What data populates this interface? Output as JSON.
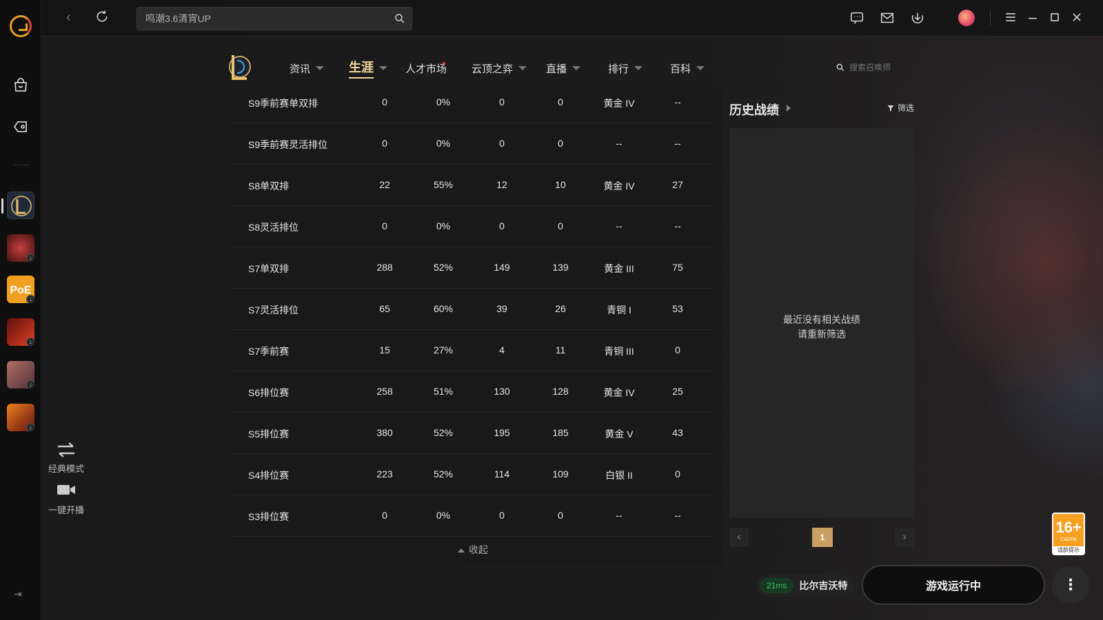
{
  "search": {
    "value": "鸣潮3.6清宵UP"
  },
  "nav": {
    "items": [
      {
        "label": "资讯"
      },
      {
        "label": "生涯"
      },
      {
        "label": "人才市场"
      },
      {
        "label": "云顶之弈"
      },
      {
        "label": "直播"
      },
      {
        "label": "排行"
      },
      {
        "label": "百科"
      }
    ],
    "summoner_search_placeholder": "搜索召唤师"
  },
  "stats_rows": [
    [
      "S9季前赛单双排",
      "0",
      "0%",
      "0",
      "0",
      "黄金 IV",
      "--"
    ],
    [
      "S9季前赛灵活排位",
      "0",
      "0%",
      "0",
      "0",
      "--",
      "--"
    ],
    [
      "S8单双排",
      "22",
      "55%",
      "12",
      "10",
      "黄金 IV",
      "27"
    ],
    [
      "S8灵活排位",
      "0",
      "0%",
      "0",
      "0",
      "--",
      "--"
    ],
    [
      "S7单双排",
      "288",
      "52%",
      "149",
      "139",
      "黄金 III",
      "75"
    ],
    [
      "S7灵活排位",
      "65",
      "60%",
      "39",
      "26",
      "青铜 I",
      "53"
    ],
    [
      "S7季前赛",
      "15",
      "27%",
      "4",
      "11",
      "青铜 III",
      "0"
    ],
    [
      "S6排位赛",
      "258",
      "51%",
      "130",
      "128",
      "黄金 IV",
      "25"
    ],
    [
      "S5排位赛",
      "380",
      "52%",
      "195",
      "185",
      "黄金 V",
      "43"
    ],
    [
      "S4排位赛",
      "223",
      "52%",
      "114",
      "109",
      "白银 II",
      "0"
    ],
    [
      "S3排位赛",
      "0",
      "0%",
      "0",
      "0",
      "--",
      "--"
    ]
  ],
  "collapse_label": "收起",
  "history": {
    "title": "历史战绩",
    "filter_label": "筛选",
    "empty_line1": "最近没有相关战绩",
    "empty_line2": "请重新筛选",
    "current_page": "1"
  },
  "quick_actions": {
    "classic_mode": "经典模式",
    "one_click_live": "一键开播"
  },
  "age_rating": {
    "value": "16+",
    "sub": "CADPA",
    "tip": "适龄提示"
  },
  "status": {
    "ping": "21ms",
    "server": "比尔吉沃特",
    "launch_label": "游戏运行中"
  },
  "colors": {
    "accent_gold": "#f0d79c",
    "page_active": "#c8a064",
    "ping_green": "#3fbf6a"
  }
}
